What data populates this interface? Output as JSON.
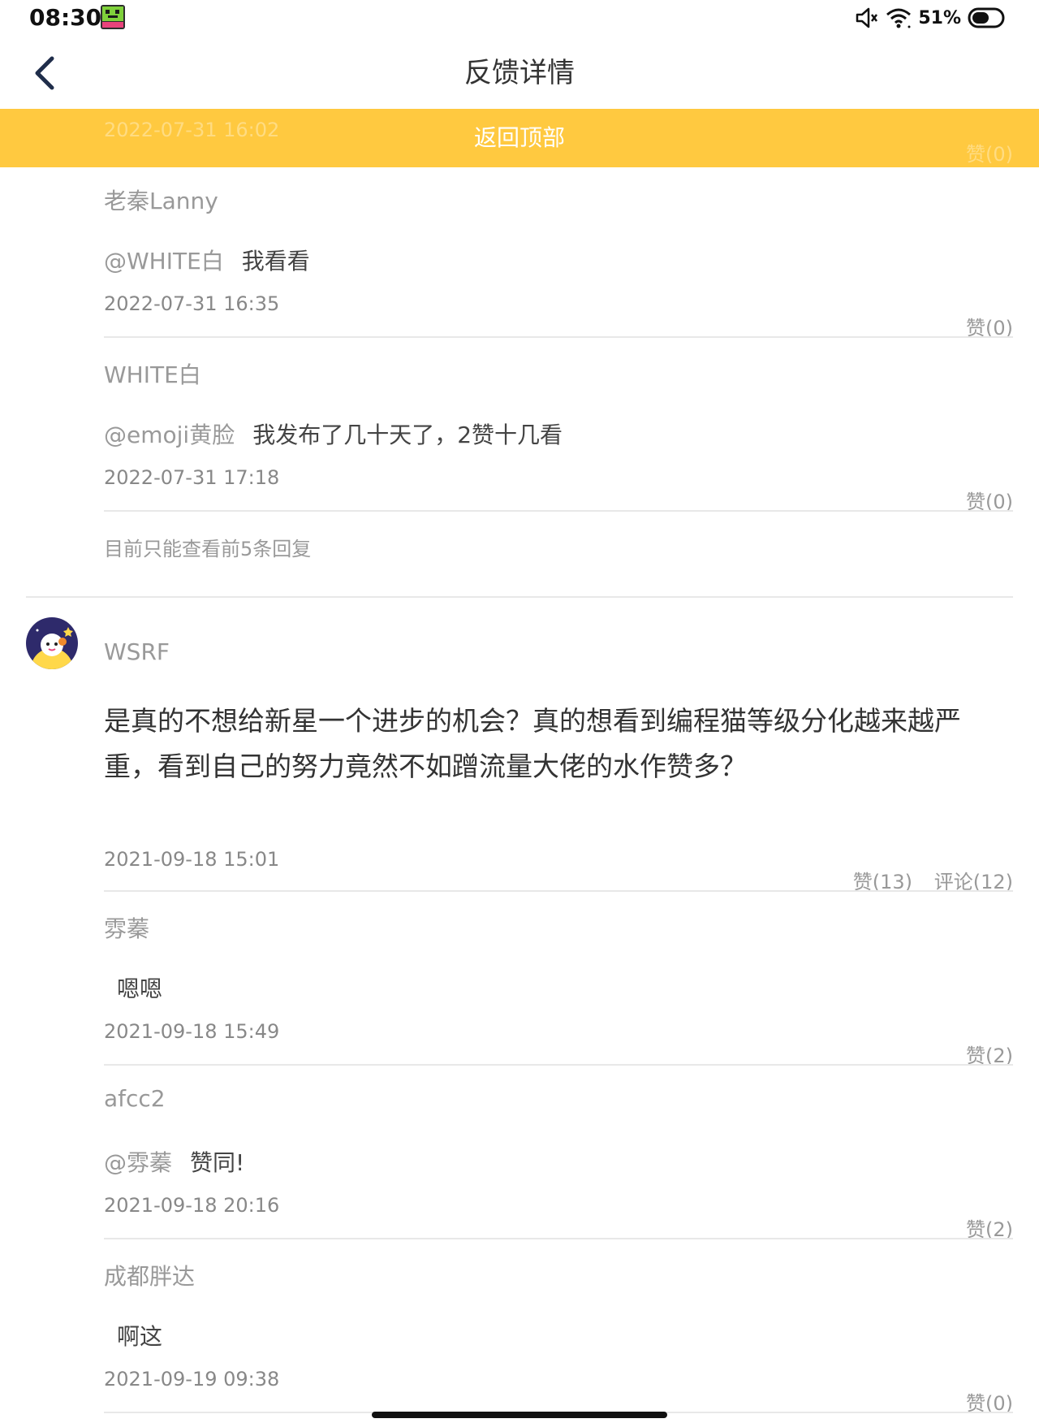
{
  "status_bar": {
    "time": "08:30",
    "battery_percent": "51%",
    "icons": [
      "app-icon",
      "mute-icon",
      "wifi-icon",
      "battery-icon"
    ]
  },
  "header": {
    "title": "反馈详情",
    "back_icon": "chevron-left-icon"
  },
  "banner": {
    "label": "返回顶部",
    "bg_color": "#FFC940",
    "ghost_time": "2022-07-31 16:02",
    "ghost_like": "赞(0)"
  },
  "replies_top": [
    {
      "name": "老秦Lanny",
      "mention": "@WHITE白",
      "text": "我看看",
      "time": "2022-07-31 16:35",
      "like": "赞(0)"
    },
    {
      "name": "WHITE白",
      "mention": "@emoji黄脸",
      "text": "我发布了几十天了，2赞十几看",
      "time": "2022-07-31 17:18",
      "like": "赞(0)"
    }
  ],
  "more_note": "目前只能查看前5条回复",
  "post": {
    "author": "WSRF",
    "content": "是真的不想给新星一个进步的机会？真的想看到编程猫等级分化越来越严重，看到自己的努力竟然不如蹭流量大佬的水作赞多？",
    "time": "2021-09-18 15:01",
    "likes": "赞(13)",
    "comments": "评论(12)"
  },
  "replies_bottom": [
    {
      "name": "雰蓁",
      "mention": "",
      "text": "嗯嗯",
      "time": "2021-09-18 15:49",
      "like": "赞(2)"
    },
    {
      "name": "afcc2",
      "mention": "@雰蓁",
      "text": "赞同!",
      "time": "2021-09-18 20:16",
      "like": "赞(2)"
    },
    {
      "name": "成都胖达",
      "mention": "",
      "text": "啊这",
      "time": "2021-09-19 09:38",
      "like": "赞(0)"
    }
  ]
}
